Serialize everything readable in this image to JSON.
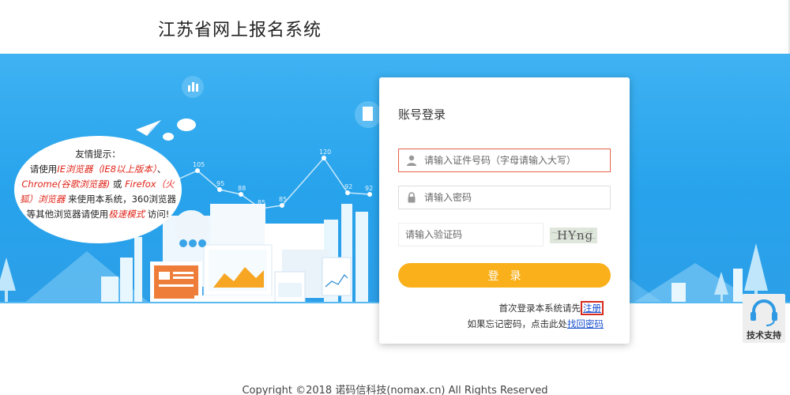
{
  "header": {
    "title": "江苏省网上报名系统"
  },
  "notice": {
    "heading": "友情提示：",
    "line1_pre": "请使用",
    "line1_red": "IE浏览器（IE8以上版本）",
    "line1_post": "、",
    "line2_red": "Chrome(谷歌浏览器)",
    "line2_mid": "或",
    "line2_red2": "Firefox（火",
    "line3_red": "狐）浏览器",
    "line3_post": "来使用本系统，360浏览器",
    "line4_pre": "等其他浏览器请使用",
    "line4_red": "极速模式",
    "line4_post": "访问!"
  },
  "chart_numbers": [
    "105",
    "95",
    "88",
    "85",
    "85",
    "120",
    "92",
    "92"
  ],
  "login": {
    "title": "账号登录",
    "id_placeholder": "请输入证件号码（字母请输入大写）",
    "password_placeholder": "请输入密码",
    "captcha_placeholder": "请输入验证码",
    "captcha_text": "HYng",
    "submit_label": "登录",
    "register_prefix": "首次登录本系统请先",
    "register_link": "注册",
    "forgot_prefix": "如果忘记密码，点击此处",
    "forgot_link": "找回密码"
  },
  "support": {
    "label": "技术支持"
  },
  "footer": {
    "copyright": "Copyright ©2018 诺码信科技(nomax.cn) All Rights Reserved"
  }
}
